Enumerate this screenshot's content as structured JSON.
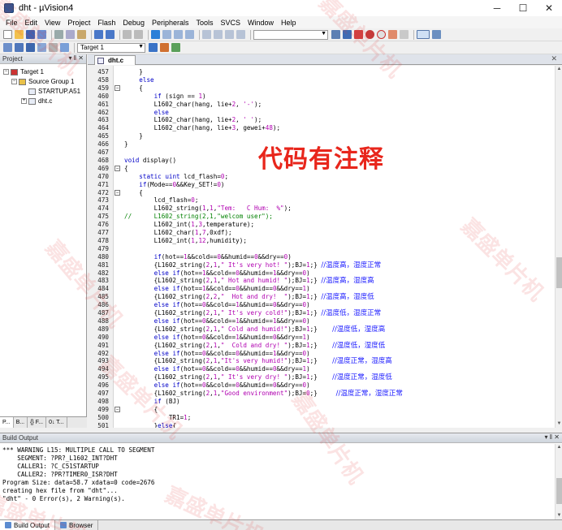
{
  "window": {
    "title": "dht - µVision4",
    "minimize": "─",
    "maximize": "☐",
    "close": "✕"
  },
  "menu": [
    "File",
    "Edit",
    "View",
    "Project",
    "Flash",
    "Debug",
    "Peripherals",
    "Tools",
    "SVCS",
    "Window",
    "Help"
  ],
  "toolbar2": {
    "target_select": "Target 1"
  },
  "project_panel": {
    "title": "Project",
    "header_buttons": "▾ ‖ ✕",
    "tree": [
      {
        "label": "Target 1",
        "expander": "−",
        "icon": "target-icon"
      },
      {
        "label": "Source Group 1",
        "expander": "−",
        "icon": "folder-icon"
      },
      {
        "label": "STARTUP.A51",
        "expander": "",
        "icon": "file-icon"
      },
      {
        "label": "dht.c",
        "expander": "+",
        "icon": "file-icon"
      }
    ],
    "tabs": [
      "P...",
      "B...",
      "{} F...",
      "0↓ T..."
    ]
  },
  "editor": {
    "tab_label": "dht.c",
    "close_label": "✕",
    "lines": [
      {
        "n": "457",
        "fold": "",
        "code": "    }"
      },
      {
        "n": "458",
        "fold": "",
        "code": "    else"
      },
      {
        "n": "459",
        "fold": "−",
        "code": "    {"
      },
      {
        "n": "460",
        "fold": "",
        "code": "        if (sign == 1)"
      },
      {
        "n": "461",
        "fold": "",
        "code": "        L1602_char(hang, lie+2, '-');"
      },
      {
        "n": "462",
        "fold": "",
        "code": "        else"
      },
      {
        "n": "463",
        "fold": "",
        "code": "        L1602_char(hang, lie+2, ' ');"
      },
      {
        "n": "464",
        "fold": "",
        "code": "        L1602_char(hang, lie+3, gewei+48);"
      },
      {
        "n": "465",
        "fold": "",
        "code": "    }"
      },
      {
        "n": "466",
        "fold": "",
        "code": "}"
      },
      {
        "n": "467",
        "fold": "",
        "code": ""
      },
      {
        "n": "468",
        "fold": "",
        "code": "void display()"
      },
      {
        "n": "469",
        "fold": "−",
        "code": "{"
      },
      {
        "n": "470",
        "fold": "",
        "code": "    static uint lcd_flash=0;"
      },
      {
        "n": "471",
        "fold": "",
        "code": "    if(Mode==0&&Key_SET!=0)"
      },
      {
        "n": "472",
        "fold": "−",
        "code": "    {"
      },
      {
        "n": "473",
        "fold": "",
        "code": "        lcd_flash=0;"
      },
      {
        "n": "474",
        "fold": "",
        "code": "        L1602_string(1,1,\"Tem:   C Hum:  %\");"
      },
      {
        "n": "475",
        "fold": "",
        "code": "//      L1602_string(2,1,\"welcom user\");"
      },
      {
        "n": "476",
        "fold": "",
        "code": "        L1602_int(1,3,temperature);"
      },
      {
        "n": "477",
        "fold": "",
        "code": "        L1602_char(1,7,0xdf);"
      },
      {
        "n": "478",
        "fold": "",
        "code": "        L1602_int(1,12,humidity);"
      },
      {
        "n": "479",
        "fold": "",
        "code": ""
      },
      {
        "n": "480",
        "fold": "",
        "code": "        if(hot==1&&cold==0&&humid==0&&dry==0)"
      },
      {
        "n": "481",
        "fold": "",
        "code": "        {L1602_string(2,1,\" It's very hot! \");BJ=1;} //温度高，湿度正常"
      },
      {
        "n": "482",
        "fold": "",
        "code": "        else if(hot==1&&cold==0&&humid==1&&dry==0)"
      },
      {
        "n": "483",
        "fold": "",
        "code": "        {L1602_string(2,1,\" Hot and humid! \");BJ=1;} //温度高，湿度高"
      },
      {
        "n": "484",
        "fold": "",
        "code": "        else if(hot==1&&cold==0&&humid==0&&dry==1)"
      },
      {
        "n": "485",
        "fold": "",
        "code": "        {L1602_string(2,2,\"  Hot and dry!  \");BJ=1;} //温度高，湿度低"
      },
      {
        "n": "486",
        "fold": "",
        "code": "        else if(hot==0&&cold==1&&humid==0&&dry==0)"
      },
      {
        "n": "487",
        "fold": "",
        "code": "        {L1602_string(2,1,\" It's very cold!\");BJ=1;} //温度低，湿度正常"
      },
      {
        "n": "488",
        "fold": "",
        "code": "        else if(hot==0&&cold==1&&humid==1&&dry==0)"
      },
      {
        "n": "489",
        "fold": "",
        "code": "        {L1602_string(2,1,\" Cold and humid!\");BJ=1;}    //温度低，湿度高"
      },
      {
        "n": "490",
        "fold": "",
        "code": "        else if(hot==0&&cold==1&&humid==0&&dry==1)"
      },
      {
        "n": "491",
        "fold": "",
        "code": "        {L1602_string(2,1,\"  Cold and dry! \");BJ=1;}    //温度低，湿度低"
      },
      {
        "n": "492",
        "fold": "",
        "code": "        else if(hot==0&&cold==0&&humid==1&&dry==0)"
      },
      {
        "n": "493",
        "fold": "",
        "code": "        {L1602_string(2,1,\"It's very humid!\");BJ=1;}    //温度正常，湿度高"
      },
      {
        "n": "494",
        "fold": "",
        "code": "        else if(hot==0&&cold==0&&humid==0&&dry==1)"
      },
      {
        "n": "495",
        "fold": "",
        "code": "        {L1602_string(2,1,\" It's very dry! \");BJ=1;}    //温度正常，湿度低"
      },
      {
        "n": "496",
        "fold": "",
        "code": "        else if(hot==0&&cold==0&&humid==0&&dry==0)"
      },
      {
        "n": "497",
        "fold": "",
        "code": "        {L1602_string(2,1,\"Good environment\");BJ=0;}     //温度正常，湿度正常"
      },
      {
        "n": "498",
        "fold": "",
        "code": "        if (BJ)"
      },
      {
        "n": "499",
        "fold": "−",
        "code": "        {"
      },
      {
        "n": "500",
        "fold": "",
        "code": "            TR1=1;"
      },
      {
        "n": "501",
        "fold": "",
        "code": "        }else{"
      }
    ]
  },
  "overlay": {
    "text": "代码有注释"
  },
  "watermark": {
    "text": "嘉盛单片机"
  },
  "build_output": {
    "title": "Build Output",
    "header_buttons": "▾ ‖ ✕",
    "lines": [
      "*** WARNING L15: MULTIPLE CALL TO SEGMENT",
      "    SEGMENT: ?PR?_L1602_INT?DHT",
      "    CALLER1: ?C_C51STARTUP",
      "    CALLER2: ?PR?TIMER0_ISR?DHT",
      "Program Size: data=58.7 xdata=0 code=2676",
      "creating hex file from \"dht\"...",
      "\"dht\" - 0 Error(s), 2 Warning(s)."
    ],
    "tabs": [
      "Build Output",
      "Browser"
    ]
  },
  "colors": {
    "overlay": "#e8261c",
    "keyword": "#0000c8",
    "comment": "#008000",
    "string": "#b000b0"
  }
}
